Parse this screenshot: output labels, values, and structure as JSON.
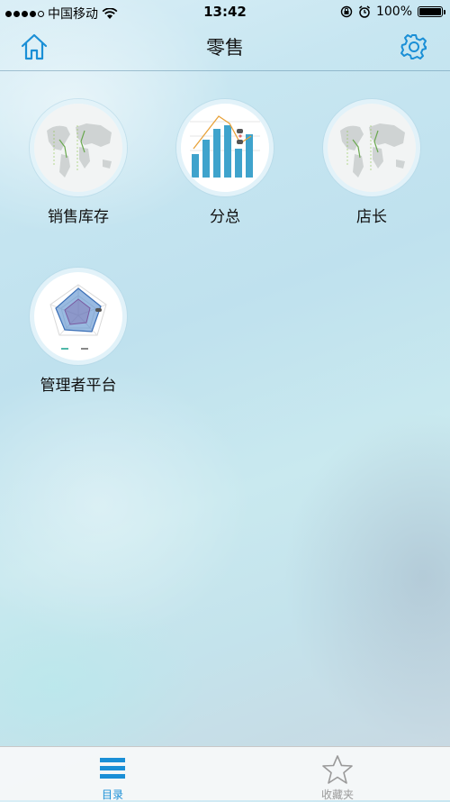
{
  "status_bar": {
    "carrier": "中国移动",
    "time": "13:42",
    "battery": "100%",
    "battery_level": 1.0,
    "signal_bars": 4
  },
  "nav": {
    "title": "零售",
    "home_icon": "home-icon",
    "settings_icon": "gear-icon"
  },
  "apps": [
    {
      "label": "销售库存",
      "icon": "world-map-icon"
    },
    {
      "label": "分总",
      "icon": "bar-chart-icon"
    },
    {
      "label": "店长",
      "icon": "world-map-icon"
    },
    {
      "label": "管理者平台",
      "icon": "radar-chart-icon"
    }
  ],
  "tab_bar": {
    "tabs": [
      {
        "label": "目录",
        "icon": "list-icon",
        "active": true
      },
      {
        "label": "收藏夹",
        "icon": "star-icon",
        "active": false
      }
    ]
  },
  "colors": {
    "accent": "#1a8fd6",
    "bar": "#3fa3cc",
    "inactive": "#9a9a9a"
  }
}
